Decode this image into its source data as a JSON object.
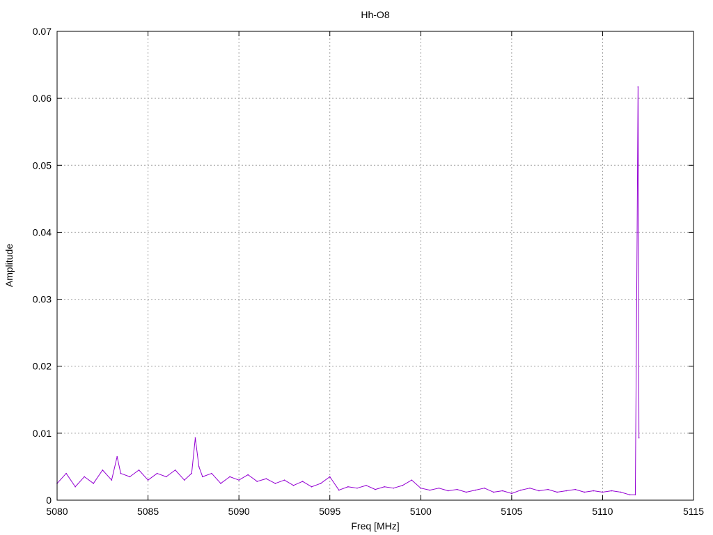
{
  "chart_data": {
    "type": "line",
    "title": "Hh-O8",
    "xlabel": "Freq [MHz]",
    "ylabel": "Amplitude",
    "xlim": [
      5080,
      5115
    ],
    "ylim": [
      0,
      0.07
    ],
    "grid": true,
    "x_ticks": [
      5080,
      5085,
      5090,
      5095,
      5100,
      5105,
      5110,
      5115
    ],
    "y_ticks": [
      0,
      0.01,
      0.02,
      0.03,
      0.04,
      0.05,
      0.06,
      0.07
    ],
    "x_tick_labels": [
      "5080",
      "5085",
      "5090",
      "5095",
      "5100",
      "5105",
      "5110",
      "5115"
    ],
    "y_tick_labels": [
      "0",
      "0.01",
      "0.02",
      "0.03",
      "0.04",
      "0.05",
      "0.06",
      "0.07"
    ],
    "series": [
      {
        "color": "#9400d3",
        "x": [
          5080.0,
          5080.5,
          5081.0,
          5081.5,
          5082.0,
          5082.5,
          5083.0,
          5083.3,
          5083.5,
          5084.0,
          5084.5,
          5085.0,
          5085.5,
          5086.0,
          5086.5,
          5087.0,
          5087.4,
          5087.6,
          5087.8,
          5088.0,
          5088.5,
          5089.0,
          5089.5,
          5090.0,
          5090.5,
          5091.0,
          5091.5,
          5092.0,
          5092.5,
          5093.0,
          5093.5,
          5094.0,
          5094.5,
          5095.0,
          5095.5,
          5096.0,
          5096.5,
          5097.0,
          5097.5,
          5098.0,
          5098.5,
          5099.0,
          5099.5,
          5100.0,
          5100.5,
          5101.0,
          5101.5,
          5102.0,
          5102.5,
          5103.0,
          5103.5,
          5104.0,
          5104.5,
          5105.0,
          5105.5,
          5106.0,
          5106.5,
          5107.0,
          5107.5,
          5108.0,
          5108.5,
          5109.0,
          5109.5,
          5110.0,
          5110.5,
          5111.0,
          5111.5,
          5111.8,
          5111.9,
          5111.95,
          5112.0
        ],
        "y": [
          0.0025,
          0.004,
          0.002,
          0.0035,
          0.0025,
          0.0045,
          0.003,
          0.0065,
          0.004,
          0.0035,
          0.0045,
          0.003,
          0.004,
          0.0035,
          0.0045,
          0.003,
          0.004,
          0.0093,
          0.005,
          0.0035,
          0.004,
          0.0025,
          0.0035,
          0.003,
          0.0038,
          0.0028,
          0.0032,
          0.0025,
          0.003,
          0.0022,
          0.0028,
          0.002,
          0.0025,
          0.0035,
          0.0015,
          0.002,
          0.0018,
          0.0022,
          0.0016,
          0.002,
          0.0018,
          0.0022,
          0.003,
          0.0018,
          0.0015,
          0.0018,
          0.0014,
          0.0016,
          0.0012,
          0.0015,
          0.0018,
          0.0012,
          0.0014,
          0.001,
          0.0015,
          0.0018,
          0.0014,
          0.0016,
          0.0012,
          0.0014,
          0.0016,
          0.0012,
          0.0014,
          0.0012,
          0.0014,
          0.0012,
          0.0008,
          0.0008,
          0.04,
          0.0617,
          0.0093
        ]
      }
    ]
  }
}
